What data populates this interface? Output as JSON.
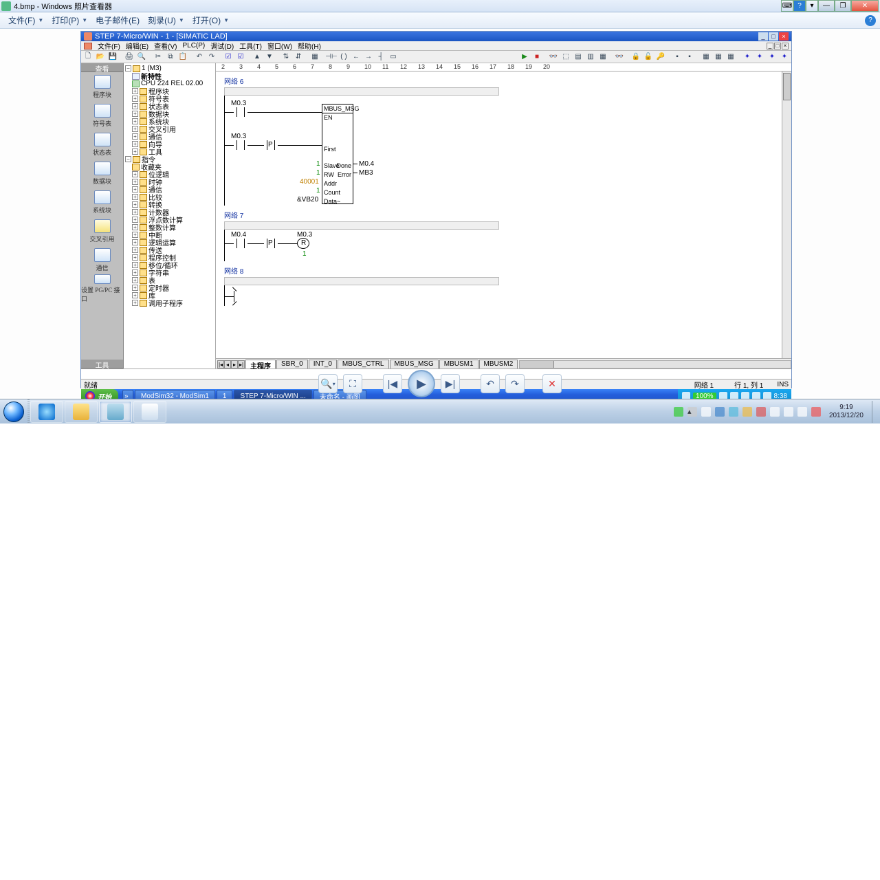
{
  "wpv": {
    "title": "4.bmp - Windows 照片查看器",
    "menu": {
      "file": "文件(F)",
      "print": "打印(P)",
      "email": "电子邮件(E)",
      "burn": "刻录(U)",
      "open": "打开(O)"
    }
  },
  "st7": {
    "title": "STEP 7-Micro/WIN - 1 - [SIMATIC LAD]",
    "menu": {
      "file": "文件(F)",
      "edit": "编辑(E)",
      "view": "查看(V)",
      "plc": "PLC(P)",
      "debug": "调试(D)",
      "tools": "工具(T)",
      "window": "窗口(W)",
      "help": "帮助(H)"
    },
    "nav": {
      "header": "查看",
      "items": [
        "程序块",
        "符号表",
        "状态表",
        "数据块",
        "系统块",
        "交叉引用",
        "通信",
        "设置 PG/PC 接口"
      ],
      "footer": "工具"
    },
    "tree": {
      "root": "1 (M3)",
      "new": "新特性",
      "cpu": "CPU 224 REL 02.00",
      "nodes": [
        "程序块",
        "符号表",
        "状态表",
        "数据块",
        "系统块",
        "交叉引用",
        "通信",
        "向导",
        "工具"
      ],
      "instr_root": "指令",
      "instr": [
        "收藏夹",
        "位逻辑",
        "时钟",
        "通信",
        "比较",
        "转换",
        "计数器",
        "浮点数计算",
        "整数计算",
        "中断",
        "逻辑运算",
        "传送",
        "程序控制",
        "移位/循环",
        "字符串",
        "表",
        "定时器",
        "库",
        "调用子程序"
      ]
    },
    "ruler": [
      "2",
      "3",
      "4",
      "5",
      "6",
      "7",
      "8",
      "9",
      "10",
      "11",
      "12",
      "13",
      "14",
      "15",
      "16",
      "17",
      "18",
      "19",
      "20"
    ],
    "net6": {
      "label": "网络 6",
      "c1": "M0.3",
      "c2": "M0.3",
      "block": "MBUS_MSG",
      "en": "EN",
      "first": "First",
      "slave": "Slave",
      "done": "Done",
      "rw": "RW",
      "error": "Error",
      "addr": "Addr",
      "count": "Count",
      "data": "Data~",
      "v_slave": "1",
      "v_rw": "1",
      "v_addr": "40001",
      "v_count": "1",
      "v_data": "&VB20",
      "o_done": "M0.4",
      "o_err": "MB3"
    },
    "net7": {
      "label": "网络 7",
      "c1": "M0.4",
      "coil": "M0.3",
      "r": "R",
      "one": "1"
    },
    "net8": {
      "label": "网络 8"
    },
    "tabs": {
      "main": "主程序",
      "t": [
        "SBR_0",
        "INT_0",
        "MBUS_CTRL",
        "MBUS_MSG",
        "MBUSM1",
        "MBUSM2"
      ]
    },
    "status": {
      "ready": "就绪",
      "net": "网络 1",
      "rowcol": "行 1, 列 1",
      "ins": "INS"
    }
  },
  "xp": {
    "start": "开始",
    "tasks": [
      "ModSim32 - ModSim1",
      "1",
      "STEP 7-Micro/WIN ...",
      "未命名 - 画图"
    ],
    "zoom": "100%",
    "clock": "8:38"
  },
  "w7": {
    "time": "9:19",
    "date": "2013/12/20"
  }
}
